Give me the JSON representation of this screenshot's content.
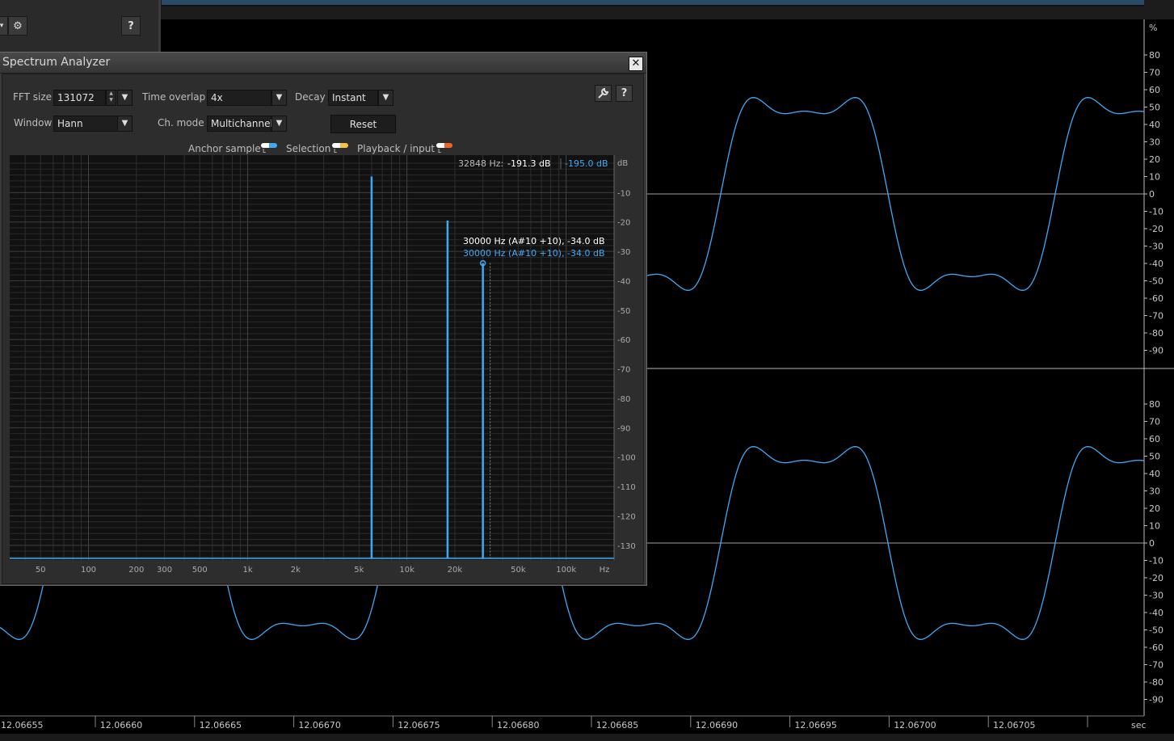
{
  "background": {
    "time_axis": {
      "unit": "sec",
      "labels": [
        "12.06655",
        "12.06660",
        "12.06665",
        "12.06670",
        "12.06675",
        "12.06680",
        "12.06685",
        "12.06690",
        "12.06695",
        "12.06700",
        "12.06705"
      ]
    },
    "amplitude_axis": {
      "unit": "%",
      "upper_labels": [
        "80",
        "70",
        "60",
        "50",
        "40",
        "30",
        "20",
        "10",
        "0",
        "-10",
        "-20",
        "-30",
        "-40",
        "-50",
        "-60",
        "-70",
        "-80",
        "-90"
      ],
      "lower_labels": [
        "80",
        "70",
        "60",
        "50",
        "40",
        "30",
        "20",
        "10",
        "0",
        "-10",
        "-20",
        "-30",
        "-40",
        "-50",
        "-60",
        "-70",
        "-80",
        "-90"
      ]
    },
    "settings_icon": "gear-icon",
    "help_label": "?"
  },
  "spectrum": {
    "title": "Spectrum Analyzer",
    "close_icon": "close-icon",
    "fft_size": {
      "label": "FFT size",
      "value": "131072"
    },
    "time_overlap": {
      "label": "Time overlap",
      "value": "4x"
    },
    "decay": {
      "label": "Decay",
      "value": "Instant"
    },
    "window": {
      "label": "Window",
      "value": "Hann"
    },
    "ch_mode": {
      "label": "Ch. mode",
      "value": "Multichannel"
    },
    "reset_label": "Reset",
    "settings_icon": "wrench-icon",
    "help_label": "?",
    "legend": {
      "anchor": {
        "label": "Anchor sample",
        "l_color": "#ffffff",
        "r_color": "#3fa9f5"
      },
      "selection": {
        "label": "Selection",
        "l_color": "#ffffff",
        "r_color": "#f5c242"
      },
      "playback": {
        "label": "Playback / input",
        "l_color": "#ffffff",
        "r_color": "#f0642a"
      },
      "lr_text": "L R"
    },
    "readout": {
      "hz": "32848 Hz:",
      "db_l": "-191.3 dB",
      "db_r": "-195.0 dB"
    },
    "peak_label_l": "30000 Hz (A#10 +10), -34.0 dB",
    "peak_label_r": "30000 Hz (A#10 +10), -34.0 dB",
    "accent_color": "#3fa9f5"
  },
  "chart_data": {
    "type": "bar",
    "xlabel": "Hz",
    "ylabel": "dB",
    "x_scale": "log",
    "x_tick_labels": [
      "50",
      "100",
      "200",
      "300",
      "500",
      "1k",
      "2k",
      "5k",
      "10k",
      "20k",
      "50k",
      "100k",
      "Hz"
    ],
    "x_tick_values": [
      50,
      100,
      200,
      300,
      500,
      1000,
      2000,
      5000,
      10000,
      20000,
      50000,
      100000
    ],
    "y_tick_labels": [
      "dB",
      "-10",
      "-20",
      "-30",
      "-40",
      "-50",
      "-60",
      "-70",
      "-80",
      "-90",
      "-100",
      "-110",
      "-120",
      "-130"
    ],
    "y_tick_values": [
      -10,
      -20,
      -30,
      -40,
      -50,
      -60,
      -70,
      -80,
      -90,
      -100,
      -110,
      -120,
      -130
    ],
    "ylim": [
      -135,
      0
    ],
    "series": [
      {
        "name": "L",
        "x": [
          6000,
          18000,
          30000
        ],
        "values": [
          -4.5,
          -19.5,
          -34.0
        ]
      }
    ],
    "grid": true
  }
}
